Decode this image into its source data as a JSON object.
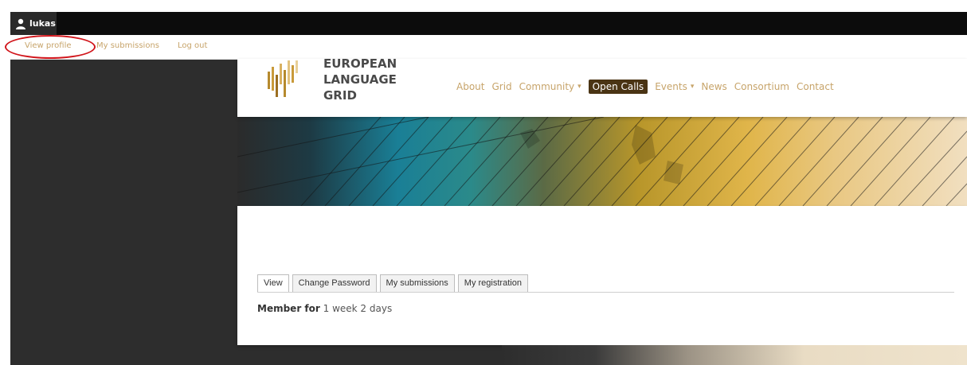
{
  "admin_bar": {
    "username": "lukas",
    "user_icon": "user-icon"
  },
  "user_tray": {
    "links": [
      "View profile",
      "My submissions",
      "Log out"
    ]
  },
  "site": {
    "logo_lines": [
      "EUROPEAN",
      "LANGUAGE",
      "GRID"
    ]
  },
  "nav": {
    "items": [
      {
        "label": "About",
        "caret": ""
      },
      {
        "label": "Grid",
        "caret": ""
      },
      {
        "label": "Community",
        "caret": "▾"
      },
      {
        "label": "Open Calls",
        "caret": ""
      },
      {
        "label": "Events",
        "caret": "▾"
      },
      {
        "label": "News",
        "caret": ""
      },
      {
        "label": "Consortium",
        "caret": ""
      },
      {
        "label": "Contact",
        "caret": ""
      }
    ],
    "active": "Open Calls"
  },
  "profile": {
    "tabs": [
      "View",
      "Change Password",
      "My submissions",
      "My registration"
    ],
    "active_tab": "View",
    "member_label": "Member for",
    "member_value": "1 week 2 days"
  },
  "colors": {
    "accent": "#c7a46a",
    "active_nav_bg": "#4a3414",
    "highlight": "#d1151b"
  }
}
